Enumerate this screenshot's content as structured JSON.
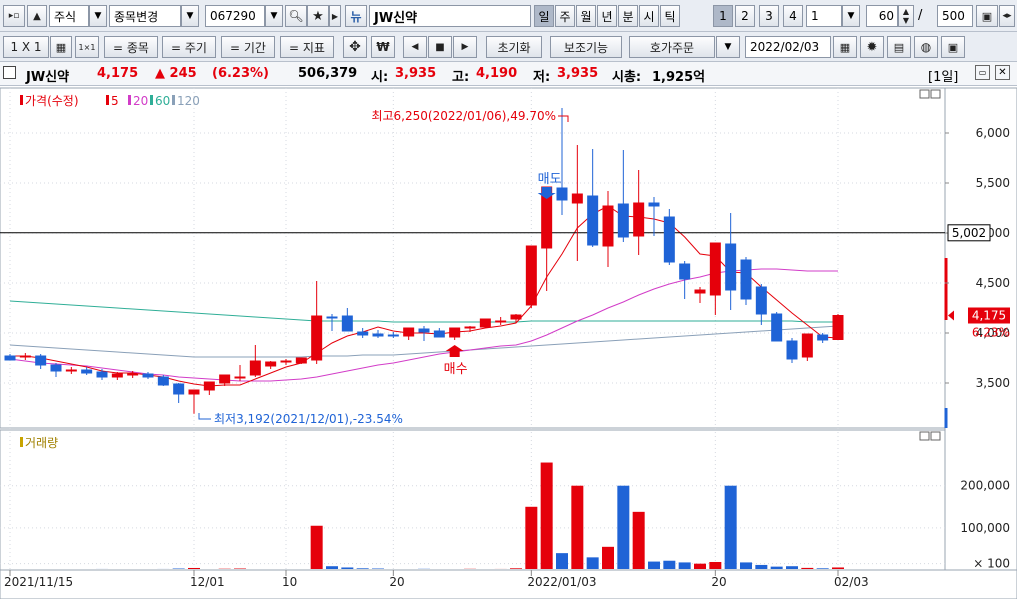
{
  "toolbar1": {
    "market": "주식",
    "change_label": "종목변경",
    "code": "067290",
    "new_label": "뉴",
    "stock_name": "JW신약",
    "periods": [
      "일",
      "주",
      "월",
      "년",
      "분",
      "시",
      "틱"
    ],
    "numbers": [
      "1",
      "2",
      "3",
      "4"
    ],
    "interval_value": "1",
    "count_value": "60",
    "slash": "/",
    "total_value": "500"
  },
  "toolbar2": {
    "layout_label": "1 X 1",
    "stock_label": "= 종목",
    "cycle_label": "= 주기",
    "period_label": "= 기간",
    "indicator_label": "= 지표",
    "won_label": "₩",
    "reset_label": "초기화",
    "aux_label": "보조기능",
    "order_label": "호가주문",
    "date_value": "2022/02/03"
  },
  "info": {
    "name": "JW신약",
    "price": "4,175",
    "change": "▲ 245",
    "change_pct": "(6.23%)",
    "volume": "506,379",
    "open_label": "시:",
    "open": "3,935",
    "high_label": "고:",
    "high": "4,190",
    "low_label": "저:",
    "low": "3,935",
    "mcap_label": "시총:",
    "mcap": "1,925억",
    "period_tag": "[1일]"
  },
  "colors": {
    "up": "#e5000b",
    "down": "#1f63d6",
    "ma5": "#e5000b",
    "ma20": "#d23cc8",
    "ma60": "#2fae97",
    "ma120": "#8aa0b8",
    "crosshair": "#000000"
  },
  "chart_data": [
    {
      "type": "candlestick",
      "legend": [
        "가격(수정)",
        "5",
        "20",
        "60",
        "120"
      ],
      "x": [
        "2021-11-15",
        "2021-11-16",
        "2021-11-17",
        "2021-11-18",
        "2021-11-19",
        "2021-11-22",
        "2021-11-23",
        "2021-11-24",
        "2021-11-25",
        "2021-11-26",
        "2021-11-29",
        "2021-11-30",
        "2021-12-01",
        "2021-12-02",
        "2021-12-03",
        "2021-12-06",
        "2021-12-07",
        "2021-12-08",
        "2021-12-09",
        "2021-12-10",
        "2021-12-13",
        "2021-12-14",
        "2021-12-15",
        "2021-12-16",
        "2021-12-17",
        "2021-12-20",
        "2021-12-21",
        "2021-12-22",
        "2021-12-23",
        "2021-12-24",
        "2021-12-27",
        "2021-12-28",
        "2021-12-29",
        "2021-12-30",
        "2022-01-03",
        "2022-01-04",
        "2022-01-05",
        "2022-01-06",
        "2022-01-07",
        "2022-01-10",
        "2022-01-11",
        "2022-01-12",
        "2022-01-13",
        "2022-01-14",
        "2022-01-17",
        "2022-01-18",
        "2022-01-19",
        "2022-01-20",
        "2022-01-21",
        "2022-01-24",
        "2022-01-25",
        "2022-01-26",
        "2022-01-27",
        "2022-01-28",
        "2022-02-03"
      ],
      "open": [
        3770,
        3760,
        3770,
        3680,
        3630,
        3630,
        3610,
        3560,
        3590,
        3590,
        3560,
        3490,
        3390,
        3430,
        3500,
        3560,
        3580,
        3670,
        3710,
        3700,
        3730,
        4160,
        4170,
        4010,
        3990,
        3980,
        3970,
        4040,
        4020,
        3960,
        4050,
        4060,
        4120,
        4140,
        4280,
        4850,
        5450,
        5300,
        5370,
        4870,
        5290,
        4970,
        5300,
        5160,
        4690,
        4400,
        4380,
        4890,
        4730,
        4460,
        4190,
        3920,
        3760,
        3980,
        3935
      ],
      "high": [
        3790,
        3800,
        3790,
        3700,
        3660,
        3660,
        3640,
        3610,
        3620,
        3610,
        3580,
        3500,
        3430,
        3470,
        3550,
        3680,
        3880,
        3720,
        3740,
        3730,
        4520,
        4190,
        4250,
        4050,
        4030,
        4010,
        4000,
        4070,
        4050,
        4000,
        4070,
        4120,
        4160,
        4190,
        4550,
        5430,
        6250,
        5880,
        5840,
        5420,
        5830,
        5630,
        5360,
        5240,
        4720,
        4460,
        4410,
        5200,
        4760,
        4490,
        4210,
        3950,
        3790,
        4000,
        4190
      ],
      "low": [
        3740,
        3730,
        3640,
        3560,
        3590,
        3580,
        3530,
        3530,
        3550,
        3540,
        3470,
        3300,
        3192,
        3380,
        3470,
        3520,
        3560,
        3640,
        3680,
        3690,
        3690,
        4020,
        4050,
        3950,
        3950,
        3950,
        3930,
        3920,
        3960,
        3930,
        4010,
        4050,
        4080,
        4100,
        4250,
        4420,
        5180,
        4720,
        4860,
        4660,
        4910,
        4780,
        4970,
        4680,
        4340,
        4300,
        4180,
        4230,
        4280,
        4080,
        3930,
        3700,
        3720,
        3900,
        3935
      ],
      "close": [
        3730,
        3770,
        3680,
        3620,
        3630,
        3600,
        3560,
        3590,
        3590,
        3560,
        3480,
        3390,
        3430,
        3510,
        3580,
        3560,
        3720,
        3710,
        3720,
        3750,
        4170,
        4150,
        4020,
        3980,
        3970,
        3970,
        4050,
        4010,
        3960,
        4050,
        4060,
        4140,
        4120,
        4180,
        4870,
        5460,
        5330,
        5390,
        4880,
        5270,
        4960,
        5300,
        5270,
        4710,
        4540,
        4430,
        4900,
        4430,
        4340,
        4190,
        3920,
        3740,
        3990,
        3930,
        4175
      ],
      "ma5": [
        3770,
        3770,
        3750,
        3720,
        3690,
        3660,
        3620,
        3600,
        3600,
        3580,
        3560,
        3520,
        3490,
        3470,
        3480,
        3480,
        3540,
        3600,
        3660,
        3700,
        3800,
        3900,
        3970,
        4010,
        4060,
        4020,
        4000,
        4000,
        3990,
        4010,
        4020,
        4050,
        4070,
        4100,
        4270,
        4560,
        4790,
        5050,
        5190,
        5270,
        5170,
        5160,
        5140,
        5100,
        4960,
        4790,
        4770,
        4610,
        4600,
        4460,
        4330,
        4200,
        4080,
        3960,
        3950
      ],
      "ma20": [
        3740,
        3720,
        3700,
        3690,
        3680,
        3670,
        3650,
        3630,
        3610,
        3590,
        3580,
        3560,
        3550,
        3540,
        3530,
        3520,
        3520,
        3520,
        3530,
        3540,
        3560,
        3590,
        3620,
        3650,
        3680,
        3700,
        3730,
        3760,
        3790,
        3810,
        3830,
        3850,
        3870,
        3880,
        3920,
        3980,
        4050,
        4120,
        4180,
        4250,
        4310,
        4380,
        4440,
        4490,
        4530,
        4560,
        4600,
        4620,
        4630,
        4640,
        4640,
        4630,
        4620,
        4620,
        4620
      ],
      "ma60": [
        4320,
        4310,
        4300,
        4290,
        4280,
        4270,
        4260,
        4250,
        4240,
        4230,
        4220,
        4210,
        4200,
        4190,
        4180,
        4170,
        4160,
        4150,
        4140,
        4130,
        4120,
        4120,
        4120,
        4120,
        4120,
        4110,
        4110,
        4110,
        4110,
        4110,
        4110,
        4110,
        4110,
        4110,
        4120,
        4120,
        4120,
        4120,
        4120,
        4120,
        4120,
        4120,
        4120,
        4120,
        4120,
        4120,
        4120,
        4120,
        4120,
        4120,
        4120,
        4120,
        4110,
        4110,
        4110
      ],
      "ma120": [
        3880,
        3870,
        3860,
        3850,
        3840,
        3830,
        3820,
        3810,
        3800,
        3790,
        3780,
        3770,
        3760,
        3760,
        3760,
        3760,
        3760,
        3760,
        3760,
        3760,
        3770,
        3770,
        3770,
        3780,
        3780,
        3780,
        3790,
        3800,
        3810,
        3820,
        3830,
        3840,
        3850,
        3860,
        3870,
        3880,
        3890,
        3900,
        3910,
        3920,
        3930,
        3940,
        3950,
        3960,
        3970,
        3980,
        3990,
        4000,
        4010,
        4020,
        4030,
        4040,
        4050,
        4060,
        4070
      ],
      "y_ticks": [
        "6,000",
        "5,500",
        "5,000",
        "4,500",
        "4,000",
        "3,500"
      ],
      "ylim": [
        3050,
        6450
      ],
      "crosshair_value": 5002,
      "crosshair_label": "5,002",
      "last_price_label": "4,175",
      "last_pct_label": "6.23%",
      "annotations": {
        "high_note": "최고6,250(2022/01/06),49.70%",
        "low_note": "최저3,192(2021/12/01),-23.54%",
        "sell_signal": "매도",
        "buy_signal": "매수"
      }
    },
    {
      "type": "bar",
      "legend": [
        "거래량"
      ],
      "values": [
        2000,
        1500,
        1800,
        1200,
        2200,
        1500,
        2500,
        1800,
        1200,
        1500,
        2500,
        3500,
        4800,
        2200,
        3000,
        3500,
        1800,
        1600,
        1400,
        1300,
        105000,
        9000,
        6000,
        4000,
        3500,
        2000,
        2000,
        2800,
        2200,
        2000,
        2800,
        2200,
        2500,
        4000,
        150000,
        255000,
        40000,
        200000,
        30000,
        55000,
        200000,
        138000,
        20000,
        22000,
        18000,
        15000,
        19000,
        200000,
        18000,
        12000,
        8000,
        9000,
        5000,
        4000,
        6000
      ],
      "y_ticks": [
        "200,000",
        "100,000",
        "× 100"
      ],
      "ylim": [
        0,
        280000
      ]
    }
  ],
  "x_axis_labels": [
    "2021/11/15",
    "12/01",
    "10",
    "20",
    "2022/01/03",
    "20",
    "02/03"
  ]
}
